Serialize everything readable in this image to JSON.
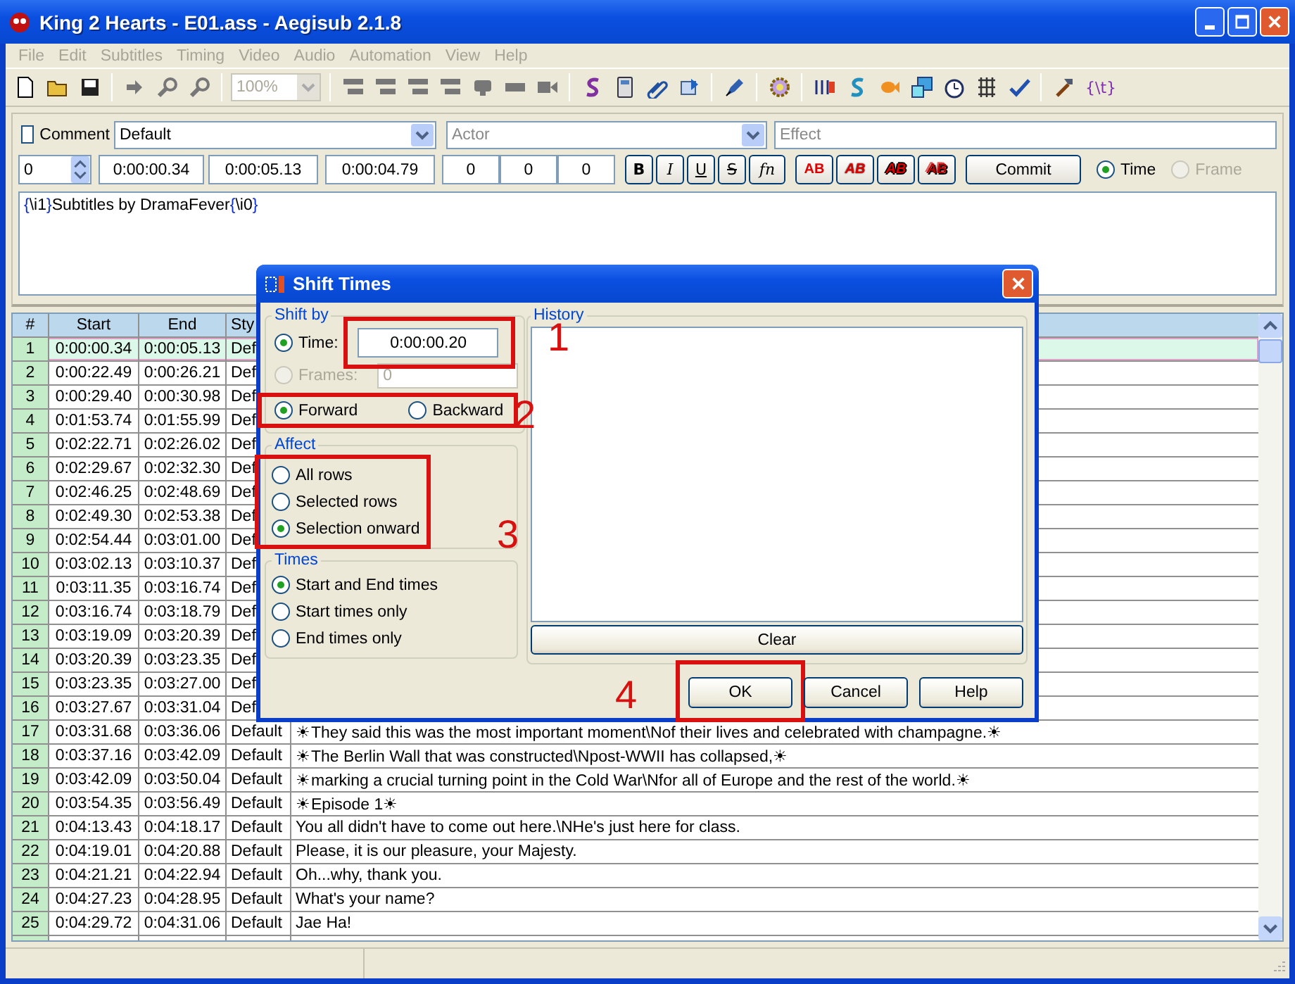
{
  "window": {
    "title": "King 2 Hearts - E01.ass - Aegisub 2.1.8"
  },
  "menu": [
    {
      "label": "File",
      "disabled": true
    },
    {
      "label": "Edit",
      "disabled": true
    },
    {
      "label": "Subtitles",
      "disabled": true
    },
    {
      "label": "Timing",
      "disabled": true
    },
    {
      "label": "Video",
      "disabled": true
    },
    {
      "label": "Audio",
      "disabled": true
    },
    {
      "label": "Automation",
      "disabled": true
    },
    {
      "label": "View",
      "disabled": true
    },
    {
      "label": "Help",
      "disabled": true
    }
  ],
  "toolbar": {
    "zoom": {
      "value": "100%",
      "disabled": true
    },
    "override_button": "{\\t}"
  },
  "edit_panel": {
    "comment": {
      "label": "Comment",
      "checked": false
    },
    "style": "Default",
    "actor": {
      "placeholder": "Actor"
    },
    "effect": {
      "placeholder": "Effect"
    },
    "layer": "0",
    "start": "0:00:00.34",
    "end": "0:00:05.13",
    "duration": "0:00:04.79",
    "margins": [
      "0",
      "0",
      "0"
    ],
    "format_buttons": [
      {
        "label": "B",
        "kind": "bold"
      },
      {
        "label": "I",
        "kind": "italic"
      },
      {
        "label": "U",
        "kind": "underline"
      },
      {
        "label": "S",
        "kind": "strike"
      },
      {
        "label": "fn",
        "kind": "font"
      }
    ],
    "color_buttons": [
      {
        "label": "AB",
        "kind": "primary"
      },
      {
        "label": "AB",
        "kind": "secondary"
      },
      {
        "label": "AB",
        "kind": "outline"
      },
      {
        "label": "AB",
        "kind": "shadow"
      }
    ],
    "commit": "Commit",
    "modes": [
      {
        "label": "Time",
        "selected": true,
        "disabled": false
      },
      {
        "label": "Frame",
        "selected": false,
        "disabled": true
      }
    ],
    "text": [
      {
        "text": "{",
        "kind": "brace"
      },
      {
        "text": "\\i1",
        "kind": "tag"
      },
      {
        "text": "}",
        "kind": "brace"
      },
      {
        "text": "Subtitles by DramaFever",
        "kind": "plain"
      },
      {
        "text": "{",
        "kind": "brace"
      },
      {
        "text": "\\i0",
        "kind": "tag"
      },
      {
        "text": "}",
        "kind": "brace"
      }
    ]
  },
  "grid": {
    "columns": [
      "#",
      "Start",
      "End",
      "Sty"
    ],
    "rows": [
      {
        "n": "1",
        "start": "0:00:00.34",
        "end": "0:00:05.13",
        "style": "Def",
        "selected": true
      },
      {
        "n": "2",
        "start": "0:00:22.49",
        "end": "0:00:26.21",
        "style": "Def",
        "selected": false
      },
      {
        "n": "3",
        "start": "0:00:29.40",
        "end": "0:00:30.98",
        "style": "Def",
        "selected": false
      },
      {
        "n": "4",
        "start": "0:01:53.74",
        "end": "0:01:55.99",
        "style": "Def",
        "selected": false
      },
      {
        "n": "5",
        "start": "0:02:22.71",
        "end": "0:02:26.02",
        "style": "Def",
        "selected": false
      },
      {
        "n": "6",
        "start": "0:02:29.67",
        "end": "0:02:32.30",
        "style": "Def",
        "selected": false
      },
      {
        "n": "7",
        "start": "0:02:46.25",
        "end": "0:02:48.69",
        "style": "Def",
        "selected": false
      },
      {
        "n": "8",
        "start": "0:02:49.30",
        "end": "0:02:53.38",
        "style": "Def",
        "selected": false
      },
      {
        "n": "9",
        "start": "0:02:54.44",
        "end": "0:03:01.00",
        "style": "Def",
        "selected": false
      },
      {
        "n": "10",
        "start": "0:03:02.13",
        "end": "0:03:10.37",
        "style": "Def",
        "selected": false
      },
      {
        "n": "11",
        "start": "0:03:11.35",
        "end": "0:03:16.74",
        "style": "Def",
        "selected": false
      },
      {
        "n": "12",
        "start": "0:03:16.74",
        "end": "0:03:18.79",
        "style": "Def",
        "selected": false
      },
      {
        "n": "13",
        "start": "0:03:19.09",
        "end": "0:03:20.39",
        "style": "Def",
        "selected": false
      },
      {
        "n": "14",
        "start": "0:03:20.39",
        "end": "0:03:23.35",
        "style": "Def",
        "selected": false
      },
      {
        "n": "15",
        "start": "0:03:23.35",
        "end": "0:03:27.00",
        "style": "Def",
        "selected": false
      },
      {
        "n": "16",
        "start": "0:03:27.67",
        "end": "0:03:31.04",
        "style": "Def",
        "selected": false
      },
      {
        "n": "17",
        "start": "0:03:31.68",
        "end": "0:03:36.06",
        "style": "Default",
        "text": "☀They said this was the most important moment\\Nof their lives and celebrated with champagne.☀",
        "selected": false
      },
      {
        "n": "18",
        "start": "0:03:37.16",
        "end": "0:03:42.09",
        "style": "Default",
        "text": "☀The Berlin Wall that was constructed\\Npost-WWII has collapsed,☀",
        "selected": false
      },
      {
        "n": "19",
        "start": "0:03:42.09",
        "end": "0:03:50.04",
        "style": "Default",
        "text": "☀marking a crucial turning point in the Cold War\\Nfor all of Europe and the rest of the world.☀",
        "selected": false
      },
      {
        "n": "20",
        "start": "0:03:54.35",
        "end": "0:03:56.49",
        "style": "Default",
        "text": "☀Episode 1☀",
        "selected": false
      },
      {
        "n": "21",
        "start": "0:04:13.43",
        "end": "0:04:18.17",
        "style": "Default",
        "text": "You all didn't have to come out here.\\NHe's just here for class.",
        "selected": false
      },
      {
        "n": "22",
        "start": "0:04:19.01",
        "end": "0:04:20.88",
        "style": "Default",
        "text": "Please, it is our pleasure, your Majesty.",
        "selected": false
      },
      {
        "n": "23",
        "start": "0:04:21.21",
        "end": "0:04:22.94",
        "style": "Default",
        "text": "Oh...why, thank you.",
        "selected": false
      },
      {
        "n": "24",
        "start": "0:04:27.23",
        "end": "0:04:28.95",
        "style": "Default",
        "text": "What's your name?",
        "selected": false
      },
      {
        "n": "25",
        "start": "0:04:29.72",
        "end": "0:04:31.06",
        "style": "Default",
        "text": "Jae Ha!",
        "selected": false
      }
    ]
  },
  "dialog": {
    "title": "Shift Times",
    "shift_by": {
      "label": "Shift by",
      "time": {
        "label": "Time:",
        "selected": true,
        "value": "0:00:00.20"
      },
      "frames": {
        "label": "Frames:",
        "selected": false,
        "disabled": true,
        "value": "0"
      },
      "direction": [
        {
          "label": "Forward",
          "selected": true
        },
        {
          "label": "Backward",
          "selected": false
        }
      ]
    },
    "affect": {
      "label": "Affect",
      "options": [
        {
          "label": "All rows",
          "selected": false
        },
        {
          "label": "Selected rows",
          "selected": false
        },
        {
          "label": "Selection onward",
          "selected": true
        }
      ]
    },
    "times": {
      "label": "Times",
      "options": [
        {
          "label": "Start and End times",
          "selected": true
        },
        {
          "label": "Start times only",
          "selected": false
        },
        {
          "label": "End times only",
          "selected": false
        }
      ]
    },
    "history": {
      "label": "History"
    },
    "clear": "Clear",
    "buttons": [
      "OK",
      "Cancel",
      "Help"
    ]
  },
  "annotations": [
    "1",
    "2",
    "3",
    "4"
  ]
}
